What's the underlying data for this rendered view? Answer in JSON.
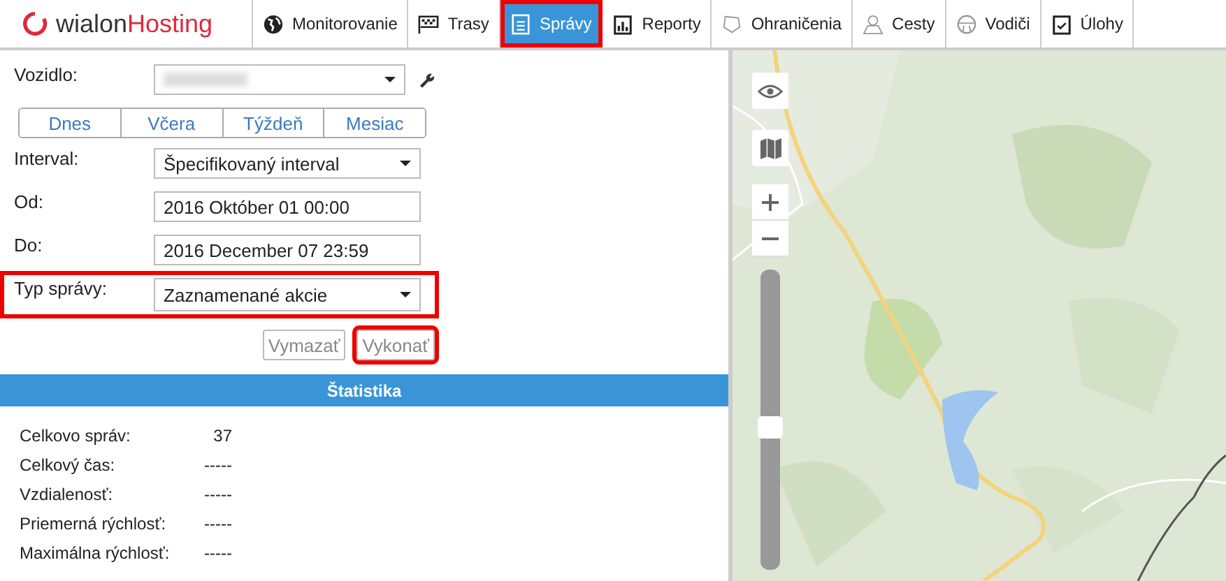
{
  "logo": {
    "first": "wialon",
    "second": "Hosting"
  },
  "tabs": [
    {
      "label": "Monitorovanie",
      "kind": "globe",
      "selected": false,
      "highlighted": false
    },
    {
      "label": "Trasy",
      "kind": "flag",
      "selected": false,
      "highlighted": false
    },
    {
      "label": "Správy",
      "kind": "document",
      "selected": true,
      "highlighted": true
    },
    {
      "label": "Reporty",
      "kind": "chart",
      "selected": false,
      "highlighted": false
    },
    {
      "label": "Ohraničenia",
      "kind": "polygon",
      "selected": false,
      "highlighted": false
    },
    {
      "label": "Cesty",
      "kind": "pin",
      "selected": false,
      "highlighted": false
    },
    {
      "label": "Vodiči",
      "kind": "wheel",
      "selected": false,
      "highlighted": false
    },
    {
      "label": "Úlohy",
      "kind": "task",
      "selected": false,
      "highlighted": false
    }
  ],
  "form": {
    "vehicle_label": "Vozidlo:",
    "periods": [
      "Dnes",
      "Včera",
      "Týždeň",
      "Mesiac"
    ],
    "fields": [
      {
        "label": "Interval:",
        "value": "Špecifikovaný interval",
        "kind": "select",
        "highlighted": false
      },
      {
        "label": "Od:",
        "value": "2016 Október 01 00:00",
        "kind": "text",
        "highlighted": false
      },
      {
        "label": "Do:",
        "value": "2016 December 07 23:59",
        "kind": "text",
        "highlighted": false
      },
      {
        "label": "Typ správy:",
        "value": "Zaznamenané akcie",
        "kind": "select",
        "highlighted": true
      }
    ],
    "buttons": [
      {
        "label": "Vymazať",
        "highlighted": false
      },
      {
        "label": "Vykonať",
        "highlighted": true
      }
    ]
  },
  "statistics": {
    "title": "Štatistika",
    "rows": [
      {
        "label": "Celkovo správ:",
        "value": "37"
      },
      {
        "label": "Celkový čas:",
        "value": "-----"
      },
      {
        "label": "Vzdialenosť:",
        "value": "-----"
      },
      {
        "label": "Priemerná rýchlosť:",
        "value": "-----"
      },
      {
        "label": "Maximálna rýchlosť:",
        "value": "-----"
      }
    ]
  },
  "map": {
    "kind": "picture",
    "zoom": {
      "level": 0.47
    }
  }
}
